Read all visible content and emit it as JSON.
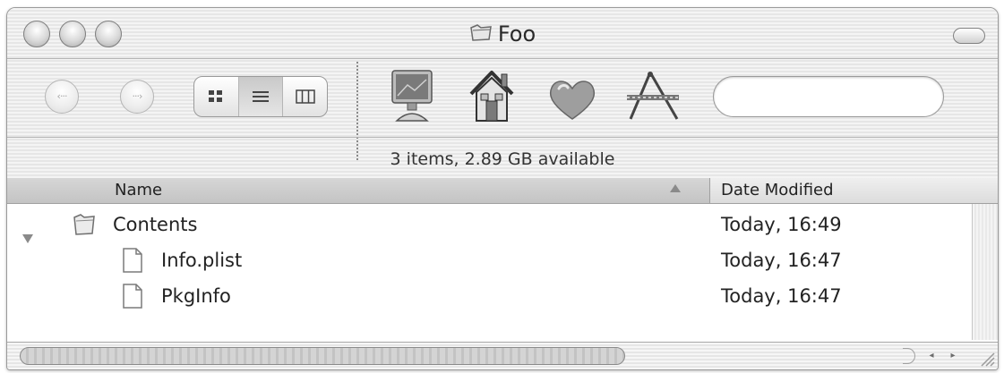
{
  "window": {
    "title": "Foo"
  },
  "toolbar": {
    "back_icon": "back-arrow-icon",
    "forward_icon": "forward-arrow-icon",
    "back_glyph": "‹···",
    "forward_glyph": "···›",
    "view_modes": [
      "icon-view-icon",
      "list-view-icon",
      "column-view-icon"
    ],
    "active_view": "list-view-icon",
    "shortcuts": [
      "computer-icon",
      "home-icon",
      "favorites-heart-icon",
      "applications-icon"
    ],
    "search": {
      "value": "",
      "placeholder": ""
    }
  },
  "status": {
    "text": "3 items, 2.89 GB available"
  },
  "list": {
    "columns": {
      "name": "Name",
      "date": "Date Modified"
    },
    "sort": "name-ascending",
    "rows": [
      {
        "name": "Contents",
        "date": "Today, 16:49",
        "kind": "folder",
        "expanded": true
      },
      {
        "name": "Info.plist",
        "date": "Today, 16:47",
        "kind": "file"
      },
      {
        "name": "PkgInfo",
        "date": "Today, 16:47",
        "kind": "file"
      }
    ]
  },
  "scrollbar": {
    "left_arrow": "◂",
    "right_arrow": "▸"
  },
  "colors": {
    "window_chrome": "#e8e8e8",
    "heart": "#9e9e9e",
    "text": "#222222"
  }
}
